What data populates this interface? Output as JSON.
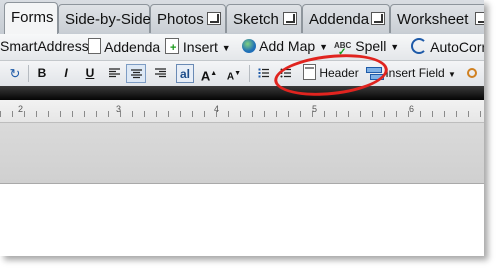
{
  "tabs": [
    {
      "label": "Forms",
      "active": true,
      "popout": false
    },
    {
      "label": "Side-by-Side",
      "active": false,
      "popout": false
    },
    {
      "label": "Photos",
      "active": false,
      "popout": true
    },
    {
      "label": "Sketch",
      "active": false,
      "popout": true
    },
    {
      "label": "Addenda",
      "active": false,
      "popout": true
    },
    {
      "label": "Worksheet",
      "active": false,
      "popout": true
    }
  ],
  "toolbar1": {
    "smartaddress": "SmartAddress",
    "addenda": "Addenda",
    "insert": "Insert",
    "add_map": "Add Map",
    "spell": "Spell",
    "autocorrect": "AutoCorr"
  },
  "toolbar2": {
    "bold": "B",
    "italic": "I",
    "underline": "U",
    "font_size": "al",
    "grow_font": "A",
    "shrink_font": "A",
    "header": "Header",
    "insert_field": "Insert Field"
  },
  "ruler": {
    "marks": [
      "2",
      "3",
      "4",
      "5",
      "6"
    ]
  },
  "colors": {
    "annotation": "#e0241f",
    "accent": "#1e5aa8"
  }
}
